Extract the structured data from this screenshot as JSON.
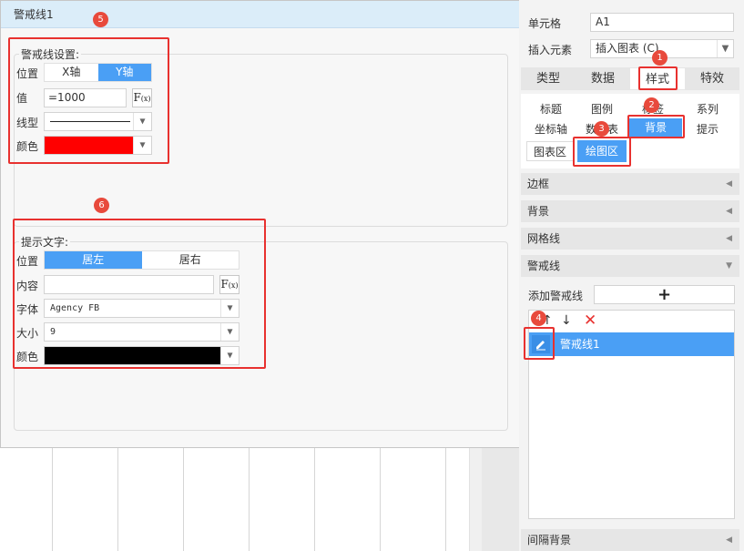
{
  "dialog": {
    "title": "警戒线1",
    "line_settings": {
      "label": "警戒线设置:",
      "position_label": "位置",
      "axis_options": [
        "X轴",
        "Y轴"
      ],
      "value_label": "值",
      "value": "=1000",
      "fx_label": "F",
      "fx_sub": "(x)",
      "line_type_label": "线型",
      "color_label": "颜色",
      "color": "#ff0000"
    },
    "hint_text": {
      "label": "提示文字:",
      "position_label": "位置",
      "align_options": [
        "居左",
        "居右"
      ],
      "content_label": "内容",
      "content_value": "",
      "fx_label": "F",
      "fx_sub": "(x)",
      "font_label": "字体",
      "font_value": "Agency FB",
      "size_label": "大小",
      "size_value": "9",
      "color_label": "颜色",
      "color": "#000000"
    }
  },
  "panel": {
    "cell_label": "单元格",
    "cell_value": "A1",
    "insert_label": "插入元素",
    "insert_value": "插入图表 (C)",
    "tabs": [
      "类型",
      "数据",
      "样式",
      "特效"
    ],
    "subtabs_row1": [
      "标题",
      "图例",
      "标签",
      "系列"
    ],
    "subtabs_row2": [
      "坐标轴",
      "数据表",
      "背景",
      "提示"
    ],
    "subtabs_row3": [
      "图表区",
      "绘图区"
    ],
    "sections": [
      "边框",
      "背景",
      "网格线",
      "警戒线"
    ],
    "add_line_label": "添加警戒线",
    "add_symbol": "+",
    "list_item": "警戒线1",
    "bottom_section": "间隔背景"
  },
  "badges": [
    "1",
    "2",
    "3",
    "4",
    "5",
    "6"
  ],
  "colors": {
    "accent": "#4a9ff5",
    "highlight": "#e8312f",
    "title_bar": "#dbedf9"
  }
}
